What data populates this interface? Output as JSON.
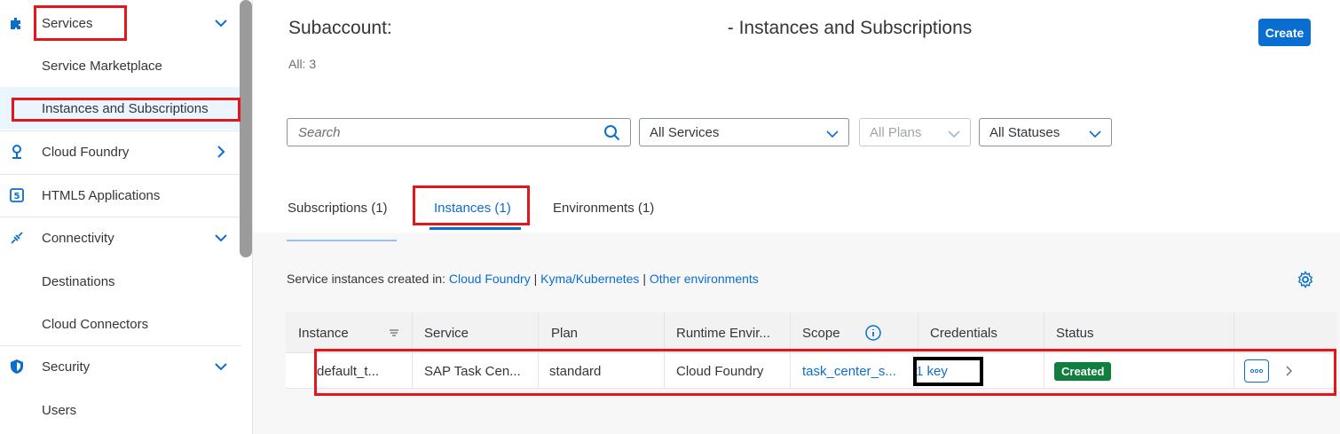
{
  "sidebar": {
    "items": [
      {
        "label": "Services",
        "icon": "puzzle-icon",
        "chevron": "down"
      },
      {
        "label": "Service Marketplace"
      },
      {
        "label": "Instances and Subscriptions"
      },
      {
        "label": "Cloud Foundry",
        "icon": "foundry-icon",
        "chevron": "right"
      },
      {
        "label": "HTML5 Applications",
        "icon": "html5-icon"
      },
      {
        "label": "Connectivity",
        "icon": "connectivity-icon",
        "chevron": "down"
      },
      {
        "label": "Destinations"
      },
      {
        "label": "Cloud Connectors"
      },
      {
        "label": "Security",
        "icon": "shield-icon",
        "chevron": "down"
      },
      {
        "label": "Users"
      }
    ]
  },
  "header": {
    "title_prefix": "Subaccount:",
    "title_suffix": "- Instances and Subscriptions",
    "count": "All: 3",
    "create_label": "Create"
  },
  "filters": {
    "search_placeholder": "Search",
    "services": "All Services",
    "plans": "All Plans",
    "statuses": "All Statuses"
  },
  "tabs": [
    {
      "label": "Subscriptions (1)",
      "active": false
    },
    {
      "label": "Instances (1)",
      "active": true
    },
    {
      "label": "Environments (1)",
      "active": false
    }
  ],
  "created_in": {
    "prefix": "Service instances created in:",
    "cloud_foundry": "Cloud Foundry",
    "sep": "|",
    "kyma": "Kyma/Kubernetes",
    "other": "Other environments"
  },
  "table": {
    "headers": [
      "Instance",
      "Service",
      "Plan",
      "Runtime Envir...",
      "Scope",
      "Credentials",
      "Status"
    ],
    "rows": [
      {
        "instance": "default_t...",
        "service": "SAP Task Cen...",
        "plan": "standard",
        "runtime": "Cloud Foundry",
        "scope": "task_center_s...",
        "credentials": "1 key",
        "status": "Created"
      }
    ]
  },
  "colors": {
    "accent": "#0a6ed1",
    "status_created": "#107e3e",
    "annotation_red": "#e3161b",
    "annotation_black": "#000000"
  }
}
